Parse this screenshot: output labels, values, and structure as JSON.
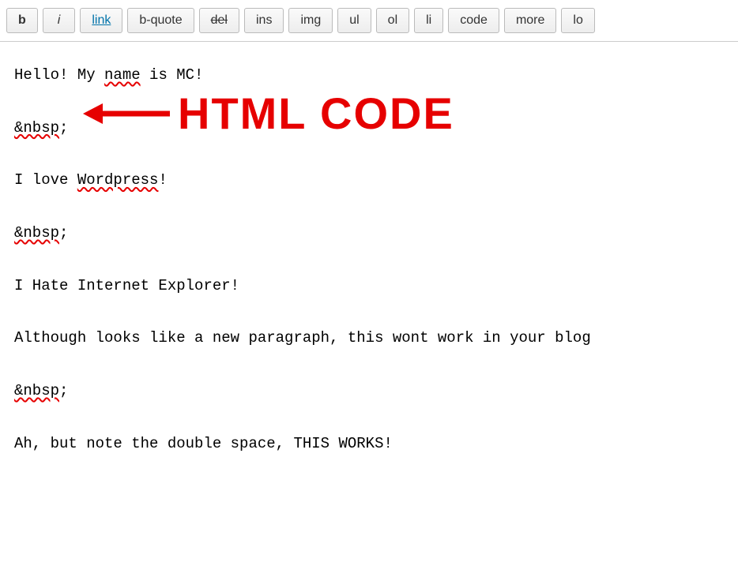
{
  "toolbar": {
    "buttons": [
      {
        "label": "b",
        "style": "bold"
      },
      {
        "label": "i",
        "style": "italic"
      },
      {
        "label": "link",
        "style": "link"
      },
      {
        "label": "b-quote",
        "style": "normal"
      },
      {
        "label": "del",
        "style": "strike"
      },
      {
        "label": "ins",
        "style": "normal"
      },
      {
        "label": "img",
        "style": "normal"
      },
      {
        "label": "ul",
        "style": "normal"
      },
      {
        "label": "ol",
        "style": "normal"
      },
      {
        "label": "li",
        "style": "normal"
      },
      {
        "label": "code",
        "style": "normal"
      },
      {
        "label": "more",
        "style": "normal"
      },
      {
        "label": "lo",
        "style": "normal"
      }
    ]
  },
  "editor": {
    "lines": {
      "l1_pre": "Hello! My ",
      "l1_err": "name",
      "l1_post": " is MC!",
      "l2_err": "&nbsp",
      "l2_post": ";",
      "l3_pre": "I love ",
      "l3_err": "Wordpress",
      "l3_post": "!",
      "l4_err": "&nbsp",
      "l4_post": ";",
      "l5": "I Hate Internet Explorer!",
      "l6": "Although looks like a new paragraph, this wont work in your blog ",
      "l7_err": "&nbsp",
      "l7_post": ";",
      "l8": "Ah, but note the double space, THIS WORKS!"
    }
  },
  "annotation": {
    "label": "HTML CODE"
  }
}
